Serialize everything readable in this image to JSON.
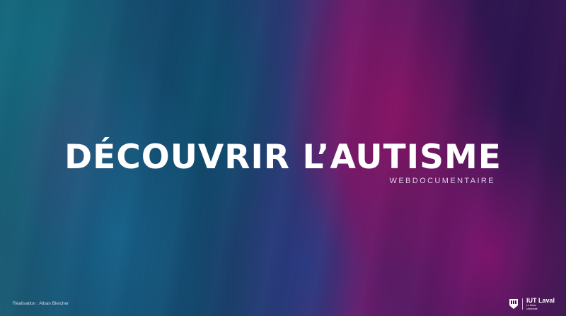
{
  "hero": {
    "title": "DÉCOUVRIR L’AUTISME",
    "subtitle": "WEBDOCUMENTAIRE"
  },
  "footer": {
    "credit": "Réalisation : Alban Bleicher",
    "logo": {
      "name": "IUT Laval",
      "university_line1": "Le Mans",
      "university_line2": "Université",
      "icon": "iut-crest-icon"
    }
  },
  "colors": {
    "text": "#ffffff",
    "teal": "#1c5c74",
    "magenta": "#8c1464",
    "deep_purple": "#2c1a4e"
  }
}
